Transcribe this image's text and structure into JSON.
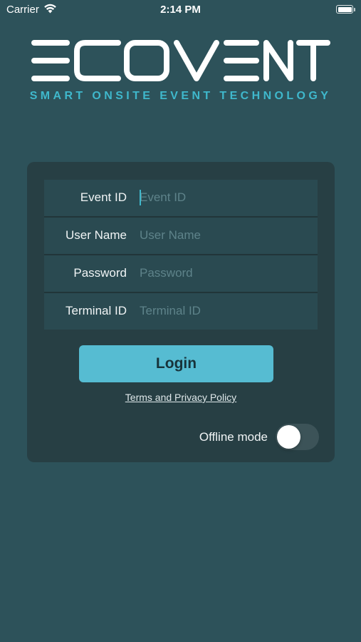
{
  "status_bar": {
    "carrier": "Carrier",
    "time": "2:14 PM",
    "wifi_icon": "wifi-icon",
    "battery_icon": "battery-icon"
  },
  "brand": {
    "logo_text": "ECOVENT",
    "tagline": "SMART ONSITE EVENT TECHNOLOGY",
    "tagline_color": "#3fb8cc"
  },
  "form": {
    "fields": [
      {
        "label": "Event ID",
        "placeholder": "Event ID",
        "value": ""
      },
      {
        "label": "User Name",
        "placeholder": "User Name",
        "value": ""
      },
      {
        "label": "Password",
        "placeholder": "Password",
        "value": ""
      },
      {
        "label": "Terminal ID",
        "placeholder": "Terminal ID",
        "value": ""
      }
    ]
  },
  "actions": {
    "login_label": "Login",
    "terms_label": "Terms and Privacy Policy",
    "offline_label": "Offline mode",
    "offline_enabled": false
  },
  "colors": {
    "background": "#2d525a",
    "card": "#273f44",
    "accent": "#56bcd2"
  }
}
